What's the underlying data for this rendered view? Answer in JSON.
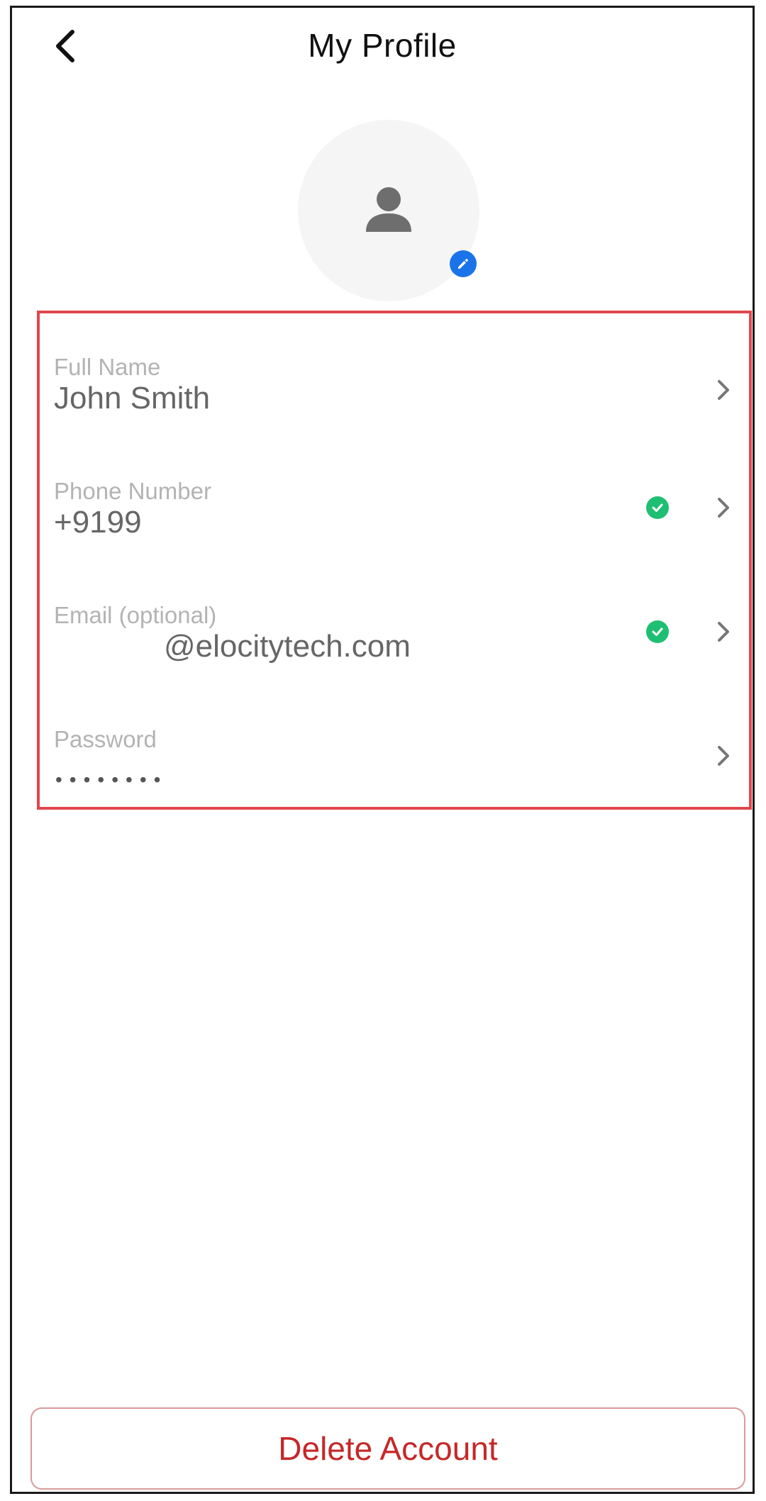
{
  "header": {
    "title": "My Profile",
    "back_icon": "chevron-left-icon"
  },
  "avatar": {
    "icon": "person-icon",
    "edit_icon": "pencil-icon",
    "edit_badge_color": "#1a73e8"
  },
  "fields": [
    {
      "label": "Full Name",
      "value": "John Smith",
      "verified": false
    },
    {
      "label": "Phone Number",
      "value": "+9199",
      "verified": true
    },
    {
      "label": "Email (optional)",
      "value": "@elocitytech.com",
      "verified": true
    },
    {
      "label": "Password",
      "value": "••••••••",
      "verified": false
    }
  ],
  "colors": {
    "highlight_border": "#e0474c",
    "verified": "#1fbf73",
    "delete_text": "#c62828"
  },
  "footer": {
    "delete_label": "Delete Account"
  }
}
